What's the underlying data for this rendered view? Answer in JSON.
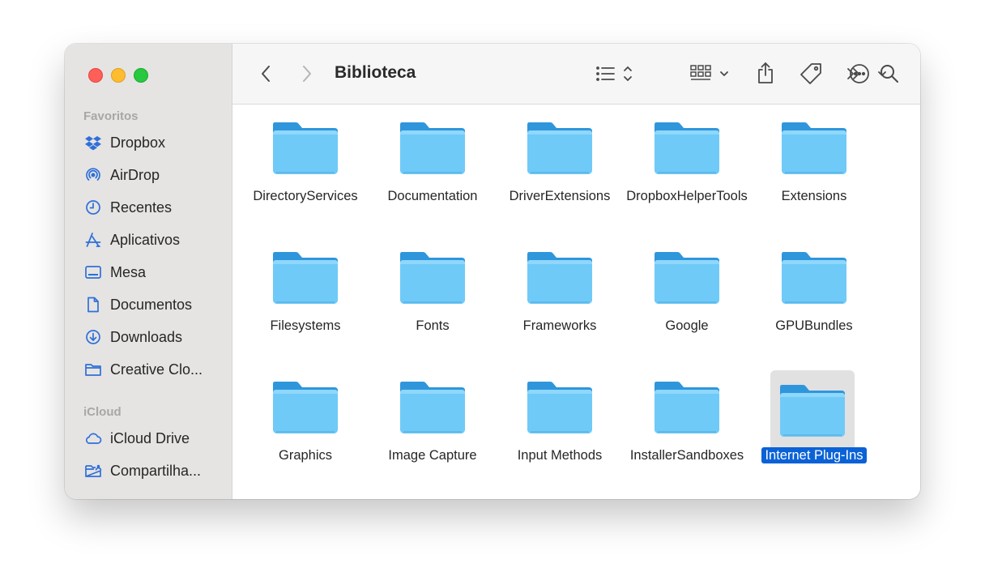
{
  "window": {
    "title": "Biblioteca"
  },
  "sidebar": {
    "favorites_title": "Favoritos",
    "favorites": [
      {
        "label": "Dropbox",
        "icon": "dropbox-icon"
      },
      {
        "label": "AirDrop",
        "icon": "airdrop-icon"
      },
      {
        "label": "Recentes",
        "icon": "clock-icon"
      },
      {
        "label": "Aplicativos",
        "icon": "applications-icon"
      },
      {
        "label": "Mesa",
        "icon": "desktop-icon"
      },
      {
        "label": "Documentos",
        "icon": "document-icon"
      },
      {
        "label": "Downloads",
        "icon": "download-icon"
      },
      {
        "label": "Creative Clo...",
        "icon": "folder-icon"
      }
    ],
    "icloud_title": "iCloud",
    "icloud": [
      {
        "label": "iCloud Drive",
        "icon": "cloud-icon"
      },
      {
        "label": "Compartilha...",
        "icon": "shared-folder-icon"
      }
    ]
  },
  "toolbar": {
    "back": "back-chevron-icon",
    "forward": "forward-chevron-icon",
    "view_mode": "list-view-icon",
    "group": "grid-group-icon",
    "share": "share-icon",
    "tag": "tag-icon",
    "more": "ellipsis-circle-icon",
    "overflow": "double-chevron-icon",
    "search": "search-icon"
  },
  "folders": [
    {
      "name": "DirectoryServices"
    },
    {
      "name": "Documentation"
    },
    {
      "name": "DriverExtensions"
    },
    {
      "name": "DropboxHelperTools"
    },
    {
      "name": "Extensions"
    },
    {
      "name": "Filesystems"
    },
    {
      "name": "Fonts"
    },
    {
      "name": "Frameworks"
    },
    {
      "name": "Google"
    },
    {
      "name": "GPUBundles"
    },
    {
      "name": "Graphics"
    },
    {
      "name": "Image Capture"
    },
    {
      "name": "Input Methods"
    },
    {
      "name": "InstallerSandboxes"
    },
    {
      "name": "Internet Plug-Ins",
      "selected": true
    }
  ],
  "colors": {
    "folder_back": "#2f96dc",
    "folder_front": "#6fcaf8",
    "selection": "#0a62d6"
  }
}
